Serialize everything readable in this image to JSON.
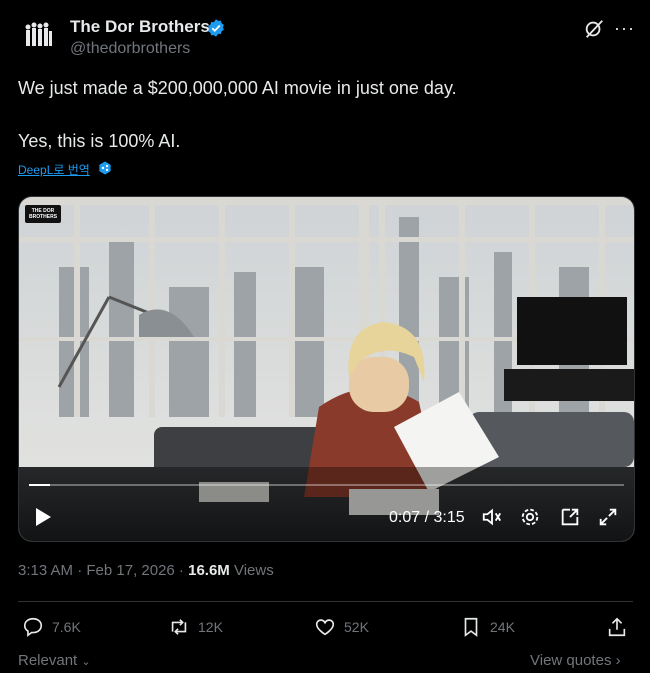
{
  "author": {
    "name": "The Dor Brothers",
    "handle": "@thedorbrothers",
    "avatar_icon": "dor-brothers-logo",
    "verified_icon": "verified-badge-icon"
  },
  "tweet": {
    "line1": "We just made a $200,000,000 AI movie in just one day.",
    "line2": "Yes, this is 100% AI.",
    "translate_label": "DeepL로 번역"
  },
  "video": {
    "badge_text": "THE DOR BROTHERS",
    "time": "0:07 / 3:15",
    "progress": 0.036,
    "controls": [
      "play-icon",
      "volume-icon",
      "settings-icon",
      "pip-icon",
      "fullscreen-icon"
    ]
  },
  "meta": {
    "time": "3:13 AM · Feb 17, 2026 · ",
    "views_count": "16.6M",
    "views_label": " Views"
  },
  "actions": {
    "replies": "7.6K",
    "reposts": "12K",
    "likes": "52K",
    "bookmarks": "24K"
  },
  "footer": {
    "relevant": "Relevant",
    "view_quotes": "View quotes"
  },
  "colors": {
    "background": "#000000",
    "text": "#e7e9ea",
    "muted": "#71767b",
    "accent": "#1d9bf0"
  }
}
